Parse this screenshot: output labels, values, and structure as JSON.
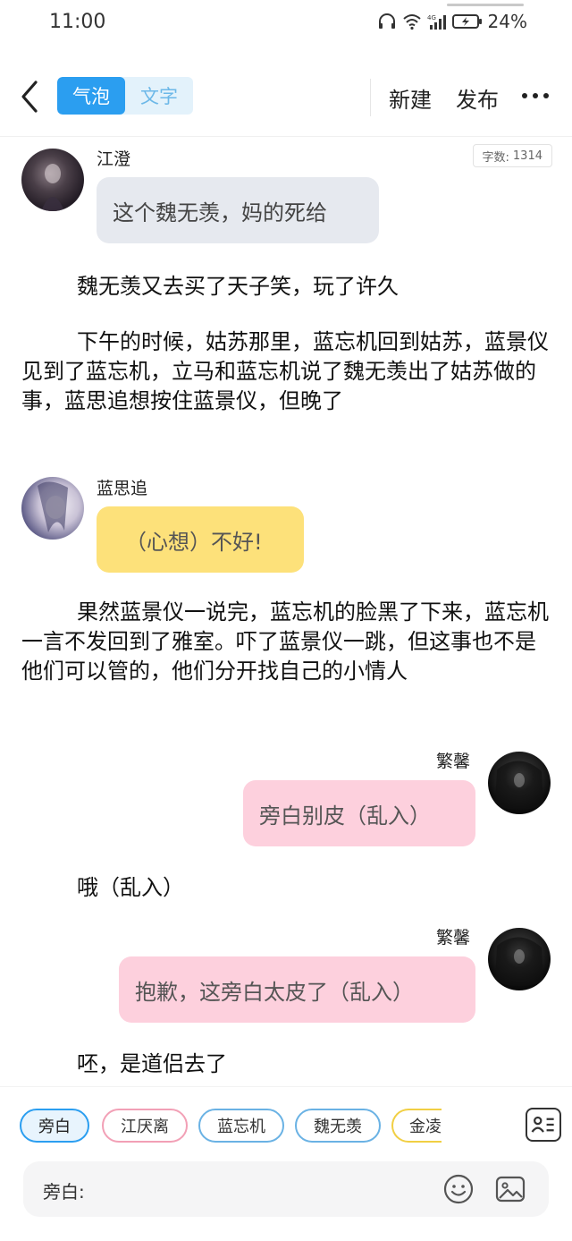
{
  "status": {
    "time": "11:00",
    "battery": "24%",
    "icons": [
      "headphones-icon",
      "wifi-icon",
      "signal-icon",
      "battery-charging-icon"
    ]
  },
  "header": {
    "tab_bubble": "气泡",
    "tab_text": "文字",
    "new_label": "新建",
    "publish_label": "发布"
  },
  "wordcount": {
    "label": "字数:",
    "value": "1314"
  },
  "story": [
    {
      "type": "dialog",
      "speaker": "江澄",
      "text": "这个魏无羡，妈的死给"
    },
    {
      "type": "narration",
      "text": "魏无羡又去买了天子笑，玩了许久"
    },
    {
      "type": "narration",
      "text": "下午的时候，姑苏那里，蓝忘机回到姑苏，蓝景仪见到了蓝忘机，立马和蓝忘机说了魏无羡出了姑苏做的事，蓝思追想按住蓝景仪，但晚了"
    },
    {
      "type": "dialog",
      "speaker": "蓝思追",
      "text": "（心想）不好!"
    },
    {
      "type": "narration",
      "text": "果然蓝景仪一说完，蓝忘机的脸黑了下来，蓝忘机一言不发回到了雅室。吓了蓝景仪一跳，但这事也不是他们可以管的，他们分开找自己的小情人"
    },
    {
      "type": "dialog",
      "speaker": "繁馨",
      "text": "旁白别皮（乱入）"
    },
    {
      "type": "narration",
      "text": "哦（乱入）"
    },
    {
      "type": "dialog",
      "speaker": "繁馨",
      "text": "抱歉，这旁白太皮了（乱入）"
    },
    {
      "type": "narration",
      "text": "呸，是道侣去了"
    }
  ],
  "roles": [
    "旁白",
    "江厌离",
    "蓝忘机",
    "魏无羡",
    "金凌"
  ],
  "input": {
    "label": "旁白:",
    "placeholder": ""
  },
  "colors": {
    "accent": "#2b9ef0",
    "bubble_gray": "#e6e9ef",
    "bubble_yellow": "#fde17a",
    "bubble_pink": "#fdd0dd"
  }
}
